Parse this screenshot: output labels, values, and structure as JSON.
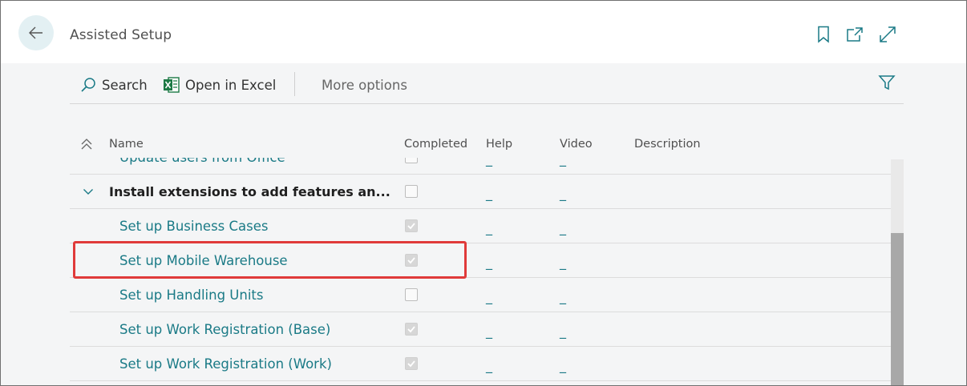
{
  "header": {
    "title": "Assisted Setup",
    "icons": [
      "back-arrow-icon",
      "bookmark-icon",
      "open-new-window-icon",
      "expand-icon"
    ]
  },
  "actions": {
    "search_label": "Search",
    "excel_label": "Open in Excel",
    "more_label": "More options"
  },
  "columns": {
    "name": "Name",
    "completed": "Completed",
    "help": "Help",
    "video": "Video",
    "description": "Description"
  },
  "rows": [
    {
      "name": "Update users from Office",
      "completed": false,
      "help": "_",
      "video": "_",
      "partial": true
    },
    {
      "name": "Install extensions to add features an...",
      "completed": false,
      "help": "_",
      "video": "_",
      "group": true
    },
    {
      "name": "Set up Business Cases",
      "completed": true,
      "help": "_",
      "video": "_"
    },
    {
      "name": "Set up Mobile Warehouse",
      "completed": true,
      "help": "_",
      "video": "_",
      "highlighted": true
    },
    {
      "name": "Set up Handling Units",
      "completed": false,
      "help": "_",
      "video": "_"
    },
    {
      "name": "Set up Work Registration (Base)",
      "completed": true,
      "help": "_",
      "video": "_"
    },
    {
      "name": "Set up Work Registration (Work)",
      "completed": true,
      "help": "_",
      "video": "_"
    }
  ],
  "colors": {
    "accent": "#1a7a86",
    "highlight": "#e03a3a",
    "back_button_bg": "#e3f0f3"
  }
}
